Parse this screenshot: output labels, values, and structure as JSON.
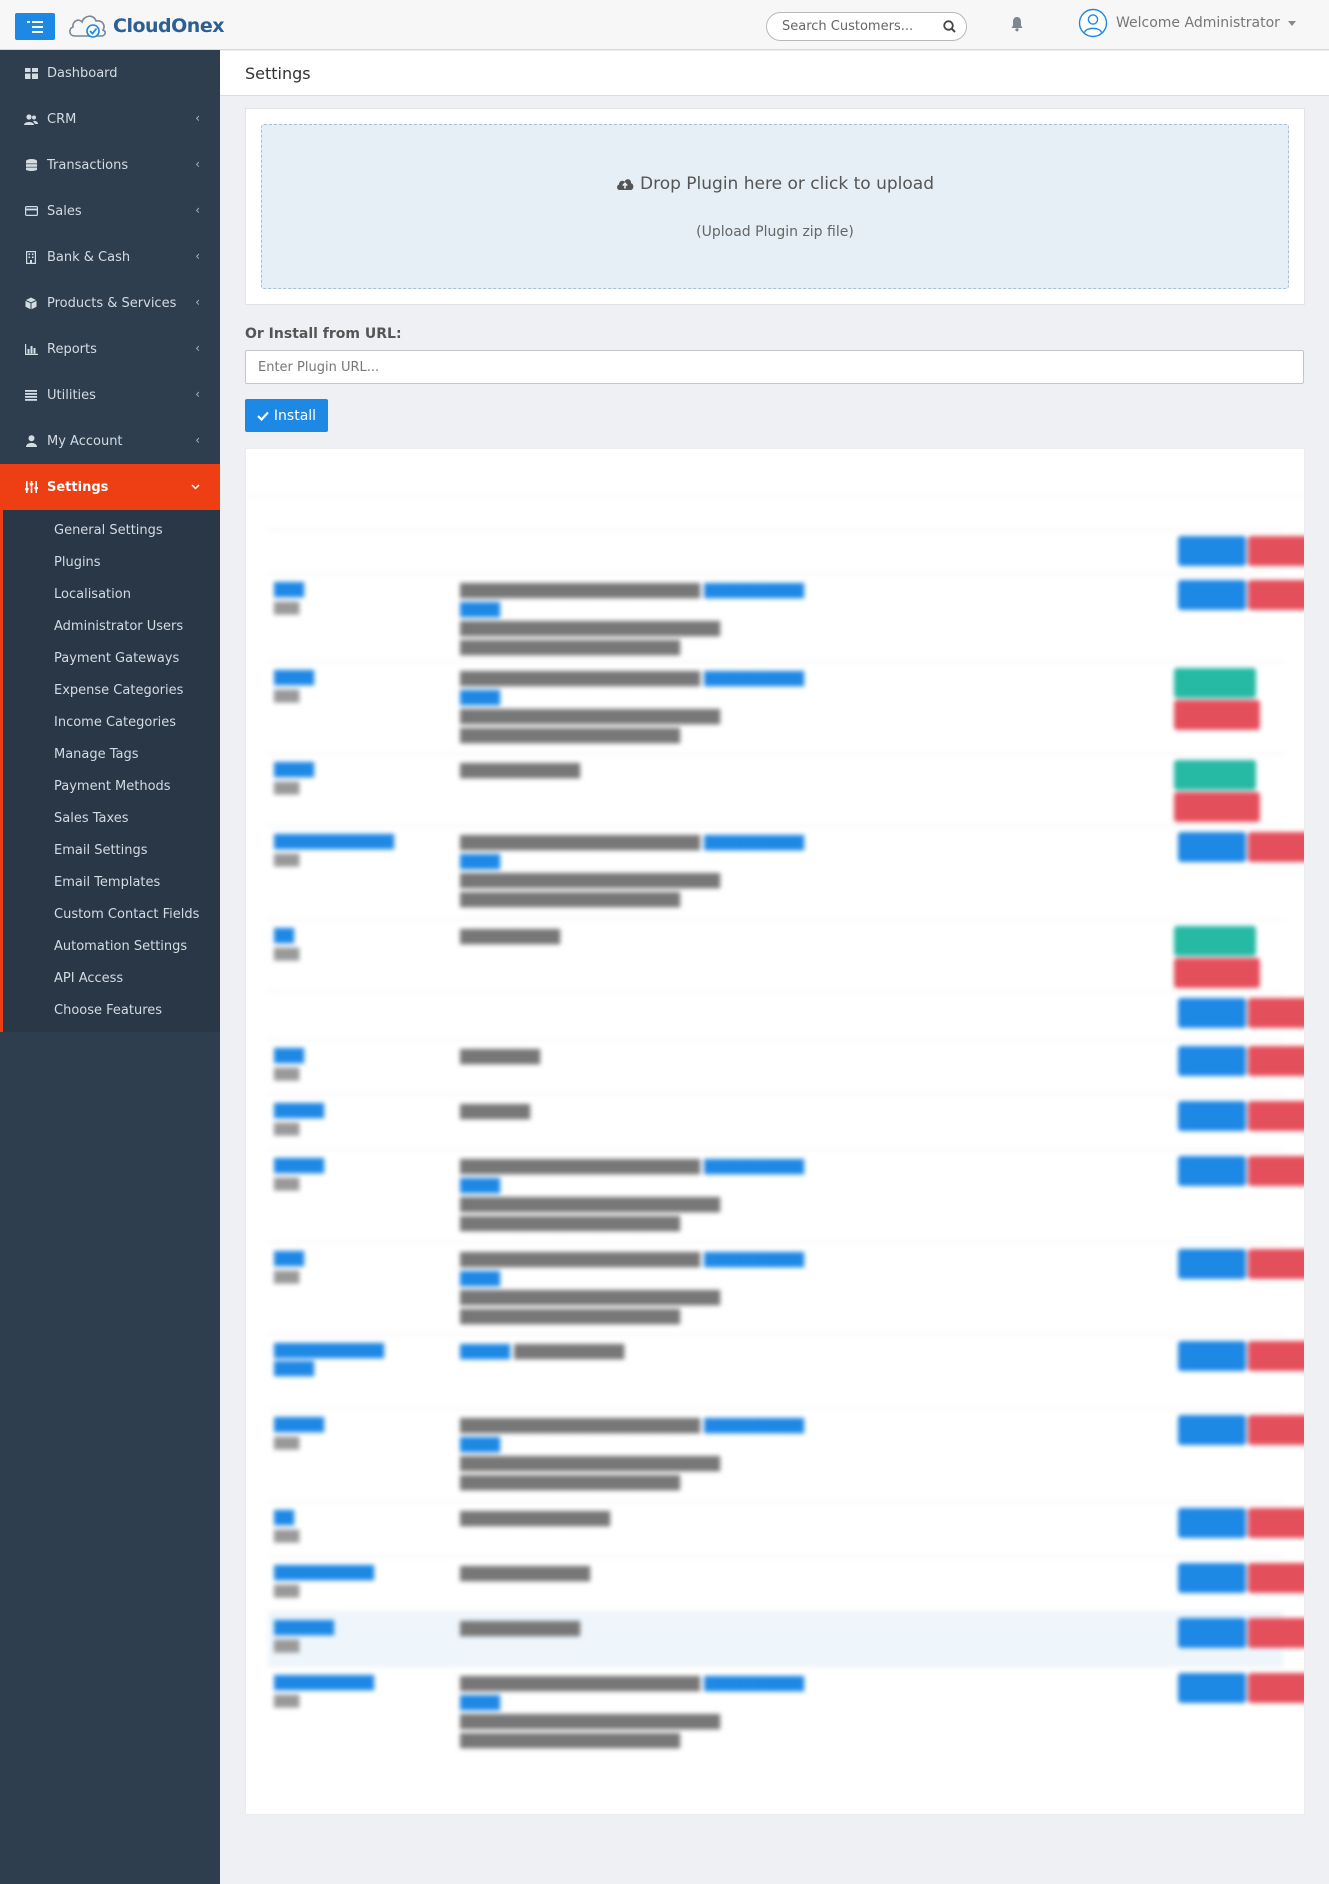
{
  "app": {
    "name": "CloudOnex"
  },
  "header": {
    "search_placeholder": "Search Customers...",
    "welcome": "Welcome Administrator"
  },
  "sidebar": {
    "items": [
      {
        "label": "Dashboard",
        "icon": "dashboard-icon",
        "has_submenu": false
      },
      {
        "label": "CRM",
        "icon": "users-icon",
        "has_submenu": true
      },
      {
        "label": "Transactions",
        "icon": "database-icon",
        "has_submenu": true
      },
      {
        "label": "Sales",
        "icon": "credit-card-icon",
        "has_submenu": true
      },
      {
        "label": "Bank & Cash",
        "icon": "building-icon",
        "has_submenu": true
      },
      {
        "label": "Products & Services",
        "icon": "cube-icon",
        "has_submenu": true
      },
      {
        "label": "Reports",
        "icon": "bar-chart-icon",
        "has_submenu": true
      },
      {
        "label": "Utilities",
        "icon": "list-icon",
        "has_submenu": true
      },
      {
        "label": "My Account",
        "icon": "user-icon",
        "has_submenu": true
      },
      {
        "label": "Settings",
        "icon": "sliders-icon",
        "has_submenu": true,
        "active": true
      }
    ],
    "settings_submenu": [
      "General Settings",
      "Plugins",
      "Localisation",
      "Administrator Users",
      "Payment Gateways",
      "Expense Categories",
      "Income Categories",
      "Manage Tags",
      "Payment Methods",
      "Sales Taxes",
      "Email Settings",
      "Email Templates",
      "Custom Contact Fields",
      "Automation Settings",
      "API Access",
      "Choose Features"
    ]
  },
  "page": {
    "title": "Settings",
    "dropzone_title": "Drop Plugin here or click to upload",
    "dropzone_subtitle": "(Upload Plugin zip file)",
    "url_label": "Or Install from URL:",
    "url_placeholder": "Enter Plugin URL...",
    "install_label": "Install"
  },
  "colors": {
    "accent": "#1e88e5",
    "active_nav": "#ee3e13",
    "sidebar_bg": "#2f3e4f",
    "danger": "#e44f5c",
    "success": "#26b9a4"
  }
}
